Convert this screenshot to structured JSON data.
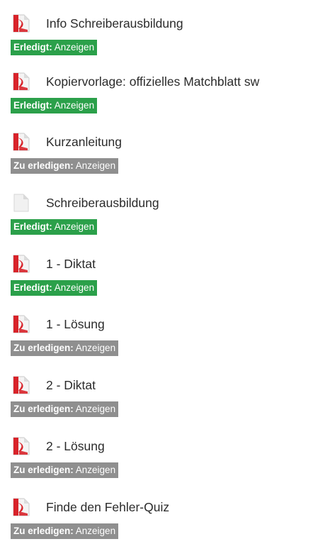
{
  "activities": [
    {
      "title": "Info Schreiberausbildung",
      "icon": "pdf-icon",
      "status": "done",
      "status_label": "Erledigt:",
      "action_label": "Anzeigen"
    },
    {
      "title": "Kopiervorlage: offizielles Matchblatt sw",
      "icon": "pdf-icon",
      "status": "done",
      "status_label": "Erledigt:",
      "action_label": "Anzeigen"
    },
    {
      "title": "Kurzanleitung",
      "icon": "pdf-icon",
      "status": "todo",
      "status_label": "Zu erledigen:",
      "action_label": "Anzeigen"
    },
    {
      "title": "Schreiberausbildung",
      "icon": "generic-file-icon",
      "status": "done",
      "status_label": "Erledigt:",
      "action_label": "Anzeigen"
    },
    {
      "title": "1 - Diktat",
      "icon": "pdf-icon",
      "status": "done",
      "status_label": "Erledigt:",
      "action_label": "Anzeigen"
    },
    {
      "title": "1 - Lösung",
      "icon": "pdf-icon",
      "status": "todo",
      "status_label": "Zu erledigen:",
      "action_label": "Anzeigen"
    },
    {
      "title": "2 - Diktat",
      "icon": "pdf-icon",
      "status": "todo",
      "status_label": "Zu erledigen:",
      "action_label": "Anzeigen"
    },
    {
      "title": "2 - Lösung",
      "icon": "pdf-icon",
      "status": "todo",
      "status_label": "Zu erledigen:",
      "action_label": "Anzeigen"
    },
    {
      "title": "Finde den Fehler-Quiz",
      "icon": "pdf-icon",
      "status": "todo",
      "status_label": "Zu erledigen:",
      "action_label": "Anzeigen"
    }
  ],
  "colors": {
    "done": "#2ba04a",
    "todo": "#8f8f8f",
    "pdf_red": "#d8232a"
  }
}
